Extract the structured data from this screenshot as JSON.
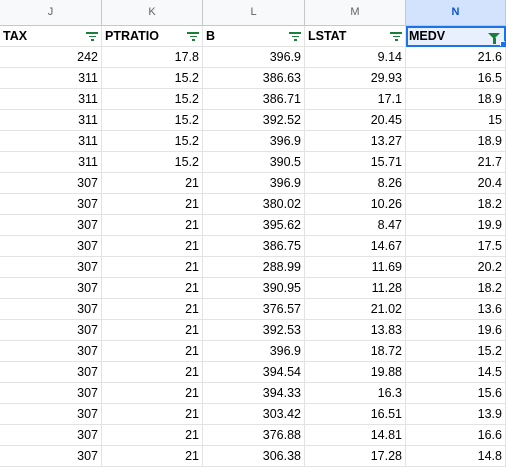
{
  "columns": [
    "J",
    "K",
    "L",
    "M",
    "N"
  ],
  "headers": [
    "TAX",
    "PTRATIO",
    "B",
    "LSTAT",
    "MEDV"
  ],
  "rows": [
    [
      "242",
      "17.8",
      "396.9",
      "9.14",
      "21.6"
    ],
    [
      "311",
      "15.2",
      "386.63",
      "29.93",
      "16.5"
    ],
    [
      "311",
      "15.2",
      "386.71",
      "17.1",
      "18.9"
    ],
    [
      "311",
      "15.2",
      "392.52",
      "20.45",
      "15"
    ],
    [
      "311",
      "15.2",
      "396.9",
      "13.27",
      "18.9"
    ],
    [
      "311",
      "15.2",
      "390.5",
      "15.71",
      "21.7"
    ],
    [
      "307",
      "21",
      "396.9",
      "8.26",
      "20.4"
    ],
    [
      "307",
      "21",
      "380.02",
      "10.26",
      "18.2"
    ],
    [
      "307",
      "21",
      "395.62",
      "8.47",
      "19.9"
    ],
    [
      "307",
      "21",
      "386.75",
      "14.67",
      "17.5"
    ],
    [
      "307",
      "21",
      "288.99",
      "11.69",
      "20.2"
    ],
    [
      "307",
      "21",
      "390.95",
      "11.28",
      "18.2"
    ],
    [
      "307",
      "21",
      "376.57",
      "21.02",
      "13.6"
    ],
    [
      "307",
      "21",
      "392.53",
      "13.83",
      "19.6"
    ],
    [
      "307",
      "21",
      "396.9",
      "18.72",
      "15.2"
    ],
    [
      "307",
      "21",
      "394.54",
      "19.88",
      "14.5"
    ],
    [
      "307",
      "21",
      "394.33",
      "16.3",
      "15.6"
    ],
    [
      "307",
      "21",
      "303.42",
      "16.51",
      "13.9"
    ],
    [
      "307",
      "21",
      "376.88",
      "14.81",
      "16.6"
    ],
    [
      "307",
      "21",
      "306.38",
      "17.28",
      "14.8"
    ]
  ],
  "selected_column": "N",
  "active_header": "MEDV",
  "colors": {
    "accent": "#1a73e8",
    "filter_icon": "#188038",
    "header_bg": "#f8f9fa",
    "selected_col_bg": "#d3e3fd"
  }
}
